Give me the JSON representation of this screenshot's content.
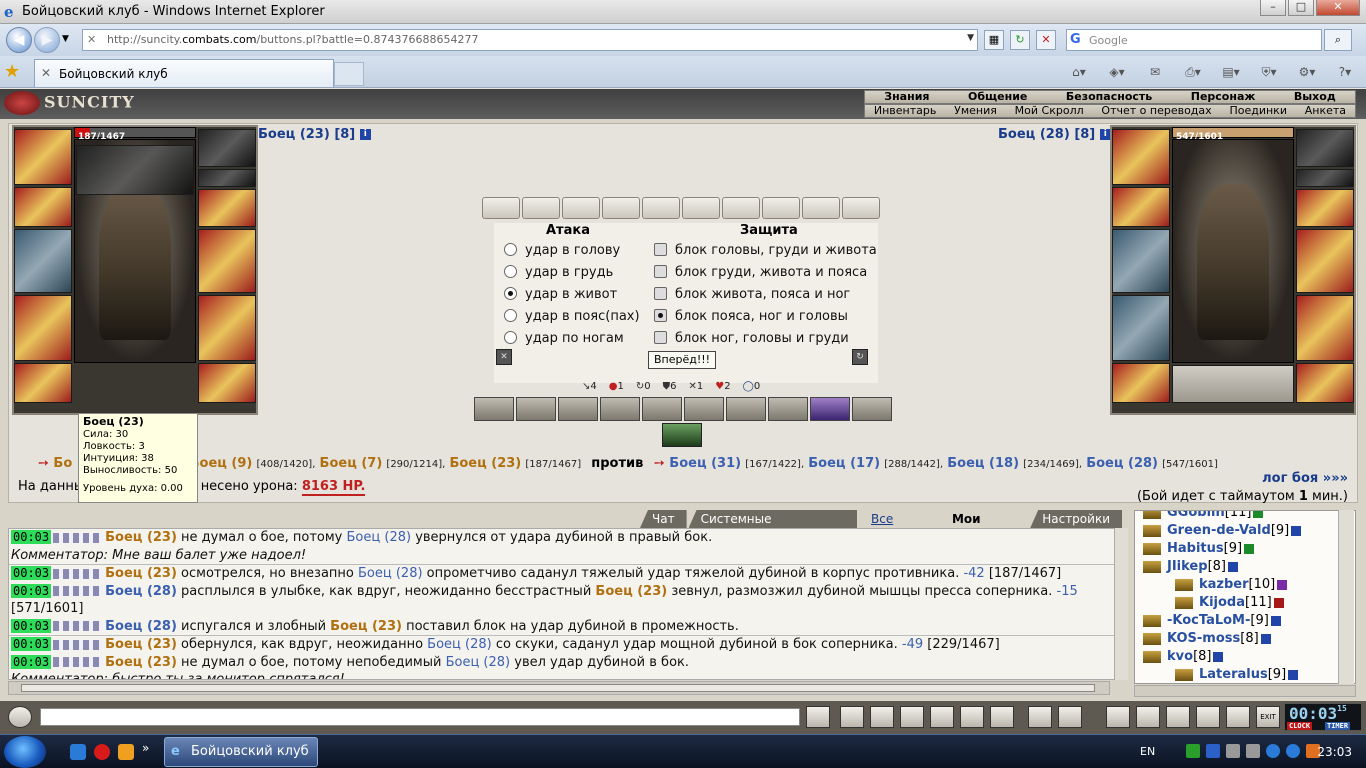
{
  "window": {
    "title": "Бойцовский клуб - Windows Internet Explorer"
  },
  "address": {
    "url_prefix": "http://suncity.",
    "url_domain": "combats.com",
    "url_rest": "/buttons.pl?battle=0.874376688654277",
    "search_placeholder": "Google"
  },
  "tab": {
    "title": "Бойцовский клуб"
  },
  "menu": {
    "row1": [
      "Знания",
      "Общение",
      "Безопасность",
      "Персонаж",
      "Выход"
    ],
    "row2": [
      "Инвентарь",
      "Умения",
      "Мой Скролл",
      "Отчет о переводах",
      "Поединки",
      "Анкета"
    ]
  },
  "logo": "SUNCITY",
  "left_fighter": {
    "name": "Боец (23) [8]",
    "hp": "187/1467",
    "hp_fraction": 0.127
  },
  "right_fighter": {
    "name": "Боец (28) [8]",
    "hp": "547/1601",
    "hp_fraction": 1.0
  },
  "attack": {
    "attack_header": "Атака",
    "defense_header": "Защита",
    "attacks": [
      "удар в голову",
      "удар в грудь",
      "удар в живот",
      "удар в пояс(пах)",
      "удар по ногам"
    ],
    "defenses": [
      "блок головы, груди и живота",
      "блок груди, живота и пояса",
      "блок живота, пояса и ног",
      "блок пояса, ног и головы",
      "блок ног, головы и груди"
    ],
    "go_button": "Вперёд!!!"
  },
  "stats": [
    "4",
    "1",
    "0",
    "6",
    "1",
    "2",
    "0"
  ],
  "tooltip": {
    "title": "Боец (23)",
    "lines": [
      "Сила: 30",
      "Ловкость: 3",
      "Интуиция: 38",
      "Выносливость: 50"
    ],
    "spirit": "Уровень духа: 0.00"
  },
  "battle": {
    "team1": [
      {
        "name": "Бо",
        "hp": ""
      },
      {
        "name": "], ",
        "hp": ""
      },
      {
        "name": "Боец (9)",
        "hp": "[408/1420],"
      },
      {
        "name": "Боец (7)",
        "hp": "[290/1214],"
      },
      {
        "name": "Боец (23)",
        "hp": "[187/1467]"
      }
    ],
    "vs": "против",
    "team2": [
      {
        "name": "Боец (31)",
        "hp": "[167/1422],"
      },
      {
        "name": "Боец (17)",
        "hp": "[288/1442],"
      },
      {
        "name": "Боец (18)",
        "hp": "[234/1469],"
      },
      {
        "name": "Боец (28)",
        "hp": "[547/1601]"
      }
    ],
    "damage_prefix": "На данный",
    "damage_mid": "несено урона:",
    "damage_value": "8163 HP.",
    "log_link": "лог боя »»»",
    "timeout": "(Бой идет с таймаутом 1 мин.)"
  },
  "chat_tabs": [
    "Чат",
    "Системные сообщения",
    "Все логи",
    "Мои логи",
    "Настройки"
  ],
  "log": [
    {
      "time": "00:03",
      "parts": [
        [
          "o",
          "Боец (23)"
        ],
        [
          "t",
          " не думал о бое, потому "
        ],
        [
          "n",
          "Боец (28)"
        ],
        [
          "t",
          " увернулся от удара дубиной в правый бок."
        ]
      ]
    },
    {
      "comment": "Комментатор: Мне ваш балет уже надоел!"
    },
    {
      "time": "00:03",
      "parts": [
        [
          "o",
          "Боец (23)"
        ],
        [
          "t",
          " осмотрелся, но внезапно "
        ],
        [
          "n",
          "Боец (28)"
        ],
        [
          "t",
          " опрометчиво саданул тяжелый удар тяжелой дубиной в корпус противника. "
        ],
        [
          "n",
          "-42"
        ],
        [
          "t",
          " [187/1467]"
        ]
      ]
    },
    {
      "time": "00:03",
      "parts": [
        [
          "b",
          "Боец (28)"
        ],
        [
          "t",
          " расплылся в улыбке, как вдруг, неожиданно бесстрастный "
        ],
        [
          "o",
          "Боец (23)"
        ],
        [
          "t",
          " зевнул, размозжил дубиной мышцы пресса соперника. "
        ],
        [
          "n",
          "-15"
        ]
      ]
    },
    {
      "cont": "[571/1601]"
    },
    {
      "time": "00:03",
      "parts": [
        [
          "b",
          "Боец (28)"
        ],
        [
          "t",
          " испугался и злобный "
        ],
        [
          "o",
          "Боец (23)"
        ],
        [
          "t",
          " поставил блок на удар дубиной в промежность."
        ]
      ]
    },
    {
      "time": "00:03",
      "parts": [
        [
          "o",
          "Боец (23)"
        ],
        [
          "t",
          " обернулся, как вдруг, неожиданно "
        ],
        [
          "n",
          "Боец (28)"
        ],
        [
          "t",
          " со скуки, саданул удар мощной дубиной в бок соперника. "
        ],
        [
          "n",
          "-49"
        ],
        [
          "t",
          " [229/1467]"
        ]
      ]
    },
    {
      "time": "00:03",
      "parts": [
        [
          "o",
          "Боец (23)"
        ],
        [
          "t",
          " не думал о бое, потому непобедимый "
        ],
        [
          "n",
          "Боец (28)"
        ],
        [
          "t",
          " увел удар дубиной в бок."
        ]
      ]
    },
    {
      "comment": "Комментатор: быстро ты за монитор спрятался!"
    }
  ],
  "users": [
    {
      "name": "GGoblin",
      "lv": "[11]"
    },
    {
      "name": "Green-de-Vald",
      "lv": "[9]"
    },
    {
      "name": "Habitus",
      "lv": "[9]"
    },
    {
      "name": "JIikep",
      "lv": "[8]"
    },
    {
      "name": "kazber",
      "lv": "[10]"
    },
    {
      "name": "Kijoda",
      "lv": "[11]"
    },
    {
      "name": "-KocTaLoM-",
      "lv": "[9]"
    },
    {
      "name": "KOS-moss",
      "lv": "[8]"
    },
    {
      "name": "kvo",
      "lv": "[8]"
    },
    {
      "name": "Lateralus",
      "lv": "[9]"
    }
  ],
  "clock": {
    "time": "00:03",
    "sec": "15",
    "label1": "CLOCK",
    "label2": "TIMER",
    "exit": "EXIT"
  },
  "taskbar": {
    "item": "Бойцовский клуб -...",
    "lang": "EN",
    "time": "23:03"
  }
}
